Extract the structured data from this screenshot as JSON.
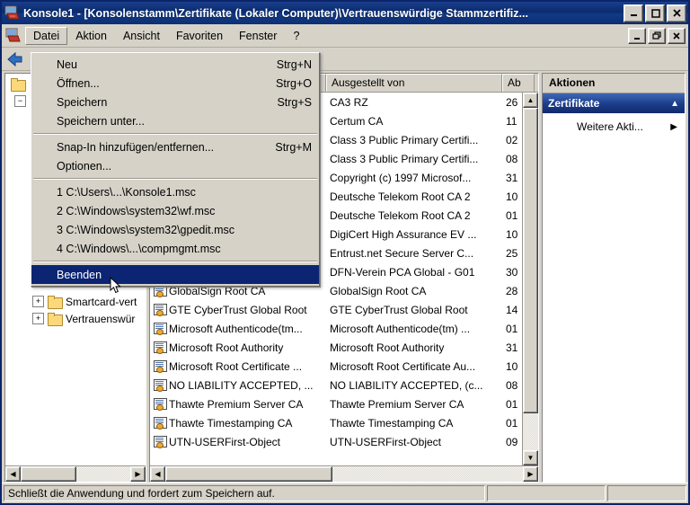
{
  "window": {
    "title": "Konsole1 - [Konsolenstamm\\Zertifikate (Lokaler Computer)\\Vertrauenswürdige Stammzertifiz...",
    "icon": "mmc-console-icon",
    "buttons": {
      "minimize": "_",
      "maximize": "❐",
      "close": "✕"
    },
    "mdi_buttons": {
      "minimize": "_",
      "restore": "❐",
      "close": "✕"
    },
    "colors": {
      "titlebar": "#0a2a6d",
      "menu_highlight": "#0b2573",
      "face": "#d6d2c8",
      "selection": "#102a6b"
    }
  },
  "menubar": {
    "icon": "mmc-small-icon",
    "items": [
      {
        "label": "Datei",
        "open": true
      },
      {
        "label": "Aktion",
        "open": false
      },
      {
        "label": "Ansicht",
        "open": false
      },
      {
        "label": "Favoriten",
        "open": false
      },
      {
        "label": "Fenster",
        "open": false
      },
      {
        "label": "?",
        "open": false
      }
    ]
  },
  "toolbar": {
    "back_icon": "back-arrow-icon"
  },
  "file_menu": {
    "groups": [
      [
        {
          "label": "Neu",
          "accel": "Strg+N",
          "selected": false
        },
        {
          "label": "Öffnen...",
          "accel": "Strg+O",
          "selected": false
        },
        {
          "label": "Speichern",
          "accel": "Strg+S",
          "selected": false
        },
        {
          "label": "Speichern unter...",
          "accel": "",
          "selected": false
        }
      ],
      [
        {
          "label": "Snap-In hinzufügen/entfernen...",
          "accel": "Strg+M",
          "selected": false
        },
        {
          "label": "Optionen...",
          "accel": "",
          "selected": false
        }
      ],
      [
        {
          "label": "1 C:\\Users\\...\\Konsole1.msc",
          "accel": "",
          "selected": false
        },
        {
          "label": "2 C:\\Windows\\system32\\wf.msc",
          "accel": "",
          "selected": false
        },
        {
          "label": "3 C:\\Windows\\system32\\gpedit.msc",
          "accel": "",
          "selected": false
        },
        {
          "label": "4 C:\\Windows\\...\\compmgmt.msc",
          "accel": "",
          "selected": false
        }
      ],
      [
        {
          "label": "Beenden",
          "accel": "",
          "selected": true
        }
      ]
    ]
  },
  "tree": {
    "items": [
      {
        "label": "Smartcard-vert",
        "expander": "+"
      },
      {
        "label": "Vertrauenswür",
        "expander": "+"
      }
    ],
    "hscroll": {
      "left_arrow": "◀",
      "right_arrow": "▶"
    }
  },
  "list": {
    "columns": [
      {
        "label": "",
        "width": 196
      },
      {
        "label": "Ausgestellt von",
        "width": 196
      },
      {
        "label": "Ab",
        "width": 36
      }
    ],
    "rows": [
      {
        "issued_to": "",
        "issued_by": "CA3 RZ",
        "expires": "26"
      },
      {
        "issued_to": "",
        "issued_by": "Certum CA",
        "expires": "11"
      },
      {
        "issued_to": ".",
        "issued_by": "Class 3 Public Primary Certifi...",
        "expires": "02"
      },
      {
        "issued_to": ".",
        "issued_by": "Class 3 Public Primary Certifi...",
        "expires": "08"
      },
      {
        "issued_to": "",
        "issued_by": "Copyright (c) 1997 Microsof...",
        "expires": "31"
      },
      {
        "issued_to": "",
        "issued_by": "Deutsche Telekom Root CA 2",
        "expires": "10"
      },
      {
        "issued_to": "l",
        "issued_by": "Deutsche Telekom Root CA 2",
        "expires": "01"
      },
      {
        "issued_to": "",
        "issued_by": "DigiCert High Assurance EV ...",
        "expires": "10"
      },
      {
        "issued_to": ".",
        "issued_by": "Entrust.net Secure Server C...",
        "expires": "25"
      },
      {
        "issued_to": ".",
        "issued_by": "DFN-Verein PCA Global - G01",
        "expires": "30"
      },
      {
        "issued_to": "GlobalSign Root CA",
        "issued_by": "GlobalSign Root CA",
        "expires": "28"
      },
      {
        "issued_to": "GTE CyberTrust Global Root",
        "issued_by": "GTE CyberTrust Global Root",
        "expires": "14"
      },
      {
        "issued_to": "Microsoft Authenticode(tm...",
        "issued_by": "Microsoft Authenticode(tm) ...",
        "expires": "01"
      },
      {
        "issued_to": "Microsoft Root Authority",
        "issued_by": "Microsoft Root Authority",
        "expires": "31"
      },
      {
        "issued_to": "Microsoft Root Certificate ...",
        "issued_by": "Microsoft Root Certificate Au...",
        "expires": "10"
      },
      {
        "issued_to": "NO LIABILITY ACCEPTED, ...",
        "issued_by": "NO LIABILITY ACCEPTED, (c...",
        "expires": "08"
      },
      {
        "issued_to": "Thawte Premium Server CA",
        "issued_by": "Thawte Premium Server CA",
        "expires": "01"
      },
      {
        "issued_to": "Thawte Timestamping CA",
        "issued_by": "Thawte Timestamping CA",
        "expires": "01"
      },
      {
        "issued_to": "UTN-USERFirst-Object",
        "issued_by": "UTN-USERFirst-Object",
        "expires": "09"
      }
    ],
    "vscroll": {
      "up_arrow": "▲",
      "down_arrow": "▼"
    },
    "hscroll": {
      "left_arrow": "◀",
      "right_arrow": "▶"
    }
  },
  "actions": {
    "header": "Aktionen",
    "title": "Zertifikate",
    "collapse_icon": "▲",
    "items": [
      {
        "label": "Weitere Akti...",
        "arrow": "▶"
      }
    ]
  },
  "statusbar": {
    "message": "Schließt die Anwendung und fordert zum Speichern auf.",
    "cell2": "",
    "cell3": ""
  },
  "cursor": {
    "name": "mouse-pointer"
  }
}
